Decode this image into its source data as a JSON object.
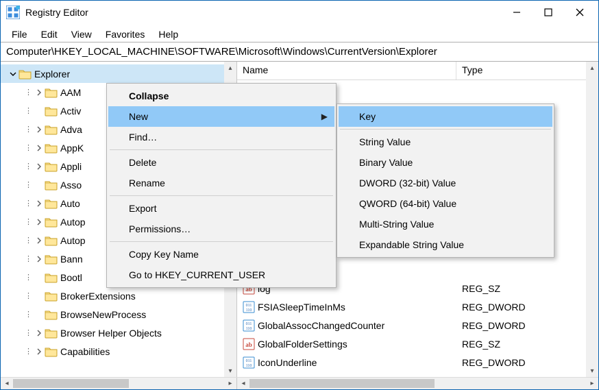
{
  "window": {
    "title": "Registry Editor"
  },
  "menu": {
    "items": [
      "File",
      "Edit",
      "View",
      "Favorites",
      "Help"
    ]
  },
  "address": {
    "value": "Computer\\HKEY_LOCAL_MACHINE\\SOFTWARE\\Microsoft\\Windows\\CurrentVersion\\Explorer"
  },
  "tree": {
    "items": [
      {
        "label": "Explorer",
        "selected": true,
        "expander": "open",
        "indent": 0
      },
      {
        "label": "AAM",
        "expander": "closed",
        "indent": 1
      },
      {
        "label": "Activ",
        "expander": "none",
        "indent": 1
      },
      {
        "label": "Adva",
        "expander": "closed",
        "indent": 1
      },
      {
        "label": "AppK",
        "expander": "closed",
        "indent": 1
      },
      {
        "label": "Appli",
        "expander": "closed",
        "indent": 1
      },
      {
        "label": "Asso",
        "expander": "none",
        "indent": 1
      },
      {
        "label": "Auto",
        "expander": "closed",
        "indent": 1
      },
      {
        "label": "Autop",
        "expander": "closed",
        "indent": 1
      },
      {
        "label": "Autop",
        "expander": "closed",
        "indent": 1
      },
      {
        "label": "Bann",
        "expander": "closed",
        "indent": 1
      },
      {
        "label": "Bootl",
        "expander": "none",
        "indent": 1
      },
      {
        "label": "BrokerExtensions",
        "expander": "none",
        "indent": 1
      },
      {
        "label": "BrowseNewProcess",
        "expander": "none",
        "indent": 1
      },
      {
        "label": "Browser Helper Objects",
        "expander": "closed",
        "indent": 1
      },
      {
        "label": "Capabilities",
        "expander": "closed",
        "indent": 1
      }
    ]
  },
  "list": {
    "columns": {
      "name": "Name",
      "type": "Type"
    },
    "rows": [
      {
        "name": "log",
        "type": "REG_SZ",
        "icon": "string"
      },
      {
        "name": "FSIASleepTimeInMs",
        "type": "REG_DWORD",
        "icon": "binary"
      },
      {
        "name": "GlobalAssocChangedCounter",
        "type": "REG_DWORD",
        "icon": "binary"
      },
      {
        "name": "GlobalFolderSettings",
        "type": "REG_SZ",
        "icon": "string"
      },
      {
        "name": "IconUnderline",
        "type": "REG_DWORD",
        "icon": "binary"
      }
    ]
  },
  "ctx1": {
    "collapse": "Collapse",
    "new": "New",
    "find": "Find…",
    "delete": "Delete",
    "rename": "Rename",
    "export": "Export",
    "permissions": "Permissions…",
    "copykey": "Copy Key Name",
    "gotohkcu": "Go to HKEY_CURRENT_USER"
  },
  "ctx2": {
    "key": "Key",
    "string": "String Value",
    "binary": "Binary Value",
    "dword": "DWORD (32-bit) Value",
    "qword": "QWORD (64-bit) Value",
    "multi": "Multi-String Value",
    "expand": "Expandable String Value"
  }
}
